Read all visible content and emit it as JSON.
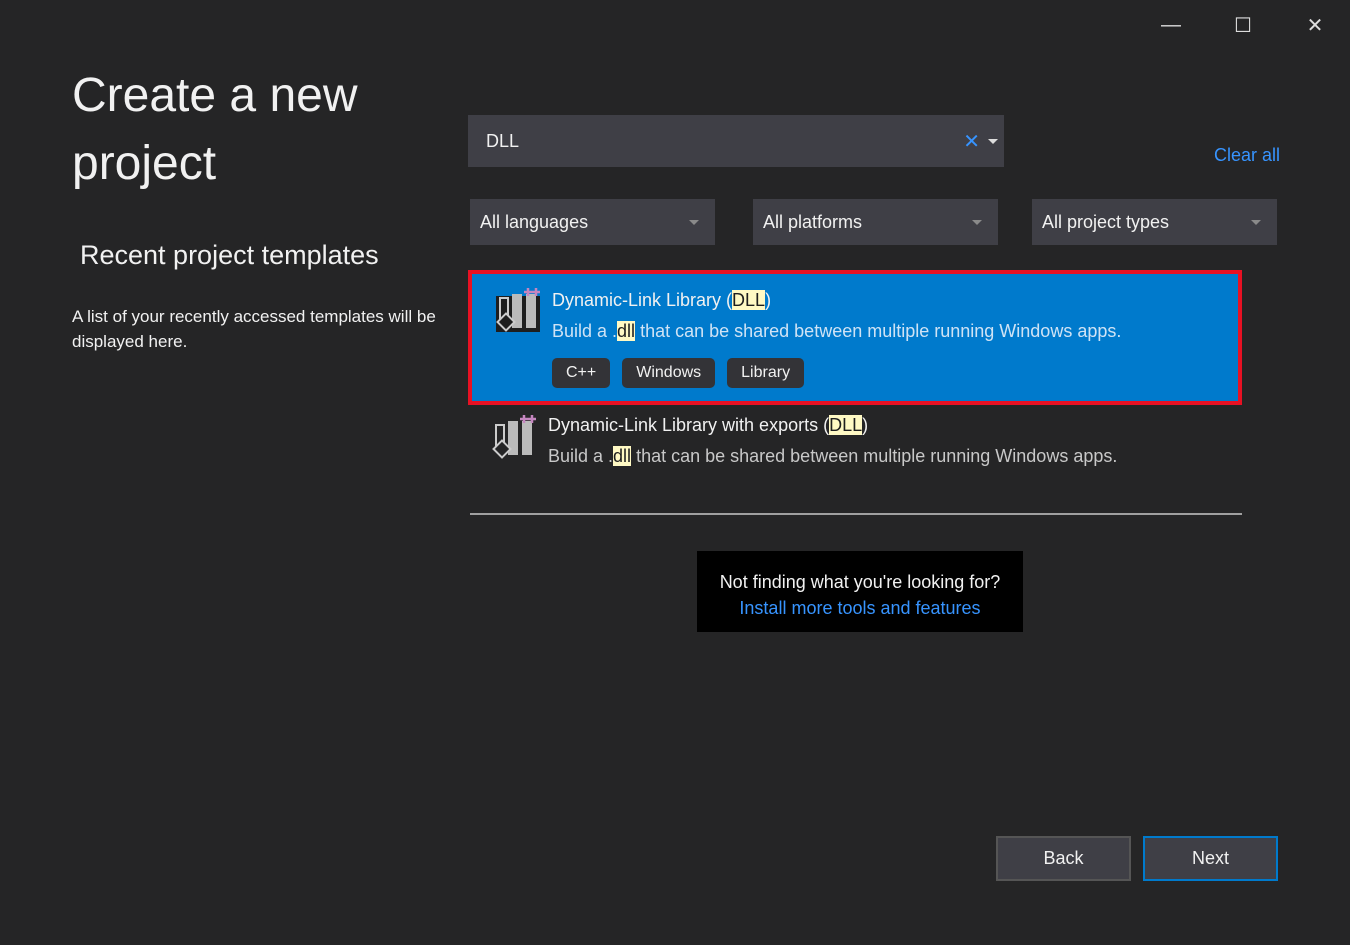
{
  "window": {
    "minimize": "—",
    "maximize": "☐",
    "close": "✕"
  },
  "page_title": "Create a new project",
  "recent": {
    "title": "Recent project templates",
    "description": "A list of your recently accessed templates will be displayed here."
  },
  "search": {
    "value": "DLL",
    "clear_icon": "✕"
  },
  "clear_all": "Clear all",
  "filters": {
    "language": "All languages",
    "platform": "All platforms",
    "project_type": "All project types"
  },
  "templates": [
    {
      "name_pre": "Dynamic-Link Library (",
      "name_hl": "DLL",
      "name_post": ")",
      "desc_pre": "Build a .",
      "desc_hl": "dll",
      "desc_post": " that can be shared between multiple running Windows apps.",
      "tags": [
        "C++",
        "Windows",
        "Library"
      ],
      "selected": true
    },
    {
      "name_pre": "Dynamic-Link Library with exports (",
      "name_hl": "DLL",
      "name_post": ")",
      "desc_pre": "Build a .",
      "desc_hl": "dll",
      "desc_post": " that can be shared between multiple running Windows apps.",
      "tags": [],
      "selected": false
    }
  ],
  "not_finding": {
    "text": "Not finding what you're looking for?",
    "link": "Install more tools and features"
  },
  "buttons": {
    "back": "Back",
    "next": "Next"
  },
  "colors": {
    "accent": "#007acc",
    "selection_border": "#e81123",
    "link": "#3794ff",
    "highlight": "#fff9c4"
  }
}
